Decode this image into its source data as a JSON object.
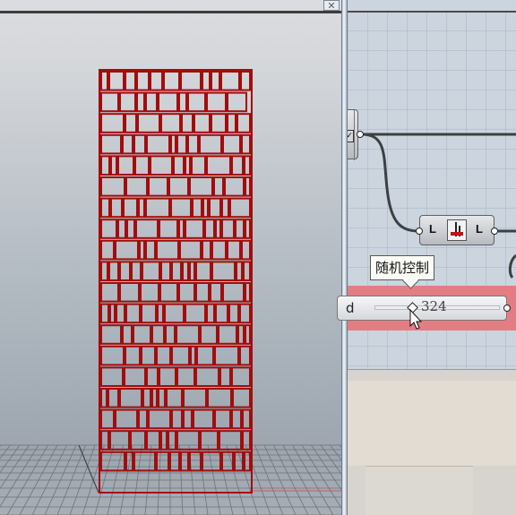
{
  "viewport": {
    "close_glyph": "✕",
    "grid_color": "#6e7378",
    "panel_color": "#a30c0c"
  },
  "canvas": {
    "left_node_mark": "✓",
    "list_node": {
      "input_label": "L",
      "output_label": "L",
      "icon": "list-item-icon"
    },
    "slider": {
      "label": "d",
      "value": "324",
      "tooltip": "随机控制"
    },
    "highlight_color": "#e47d83",
    "wire_color": "#3c3f43"
  }
}
